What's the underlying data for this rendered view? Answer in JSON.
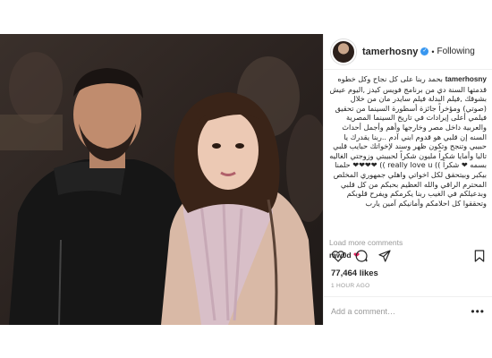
{
  "post": {
    "username": "tamerhosny",
    "verified_glyph": "✓",
    "separator": "•",
    "follow_status": "Following",
    "caption_username": "tamerhosny",
    "caption_text": "بحمد ربنا على كل نجاح وكل خطوه قدمتها السنة دي من برنامج فويس كيدز ,اليوم عيش بشوقك ,فيلم البدلة فيلم سايدر مان من خلال (صوتي) ومؤخراً جائزة أسطورة السينما من تحقيق فيلمي أعلى إيرادات في تاريخ السينما المصرية والعربية داخل مصر وخارجها وأهم وأجمل أحداث السنه إن قلبي هو قدوم ابني آدم ..ربنا يقدرك يا حبيبي وتنجح وتكون ظهر وسند لإخواتك حبايب قلبي تاليا وأمايا شكراً مليون شكراً لحبيبتي وزوجتي الغاليه بسمه ❤ شكراً )) really love u )) ❤❤❤❤ حلمنا بيكبر وبيتحقق لكل اخواتي واهلي جمهوري المخلص المحترم الراقي والله العظيم بحبكم من كل قلبي وبدعيلكم في الغيب ربنا يكرمكم ويفرح قلوبكم وتحققوا كل احلامكم وأمانيكم آمين يارب",
    "load_more": "Load more comments",
    "comment_user": "raw0d",
    "comment_text": "❤",
    "likes": "77,464 likes",
    "time": "1 HOUR AGO",
    "add_comment_placeholder": "Add a comment…",
    "more_options": "•••"
  },
  "icons": {
    "like": "heart-icon",
    "comment": "comment-icon",
    "share": "share-icon",
    "save": "bookmark-icon"
  },
  "colors": {
    "verified": "#3897f0",
    "text": "#262626",
    "muted": "#999999",
    "border": "#efefef"
  }
}
